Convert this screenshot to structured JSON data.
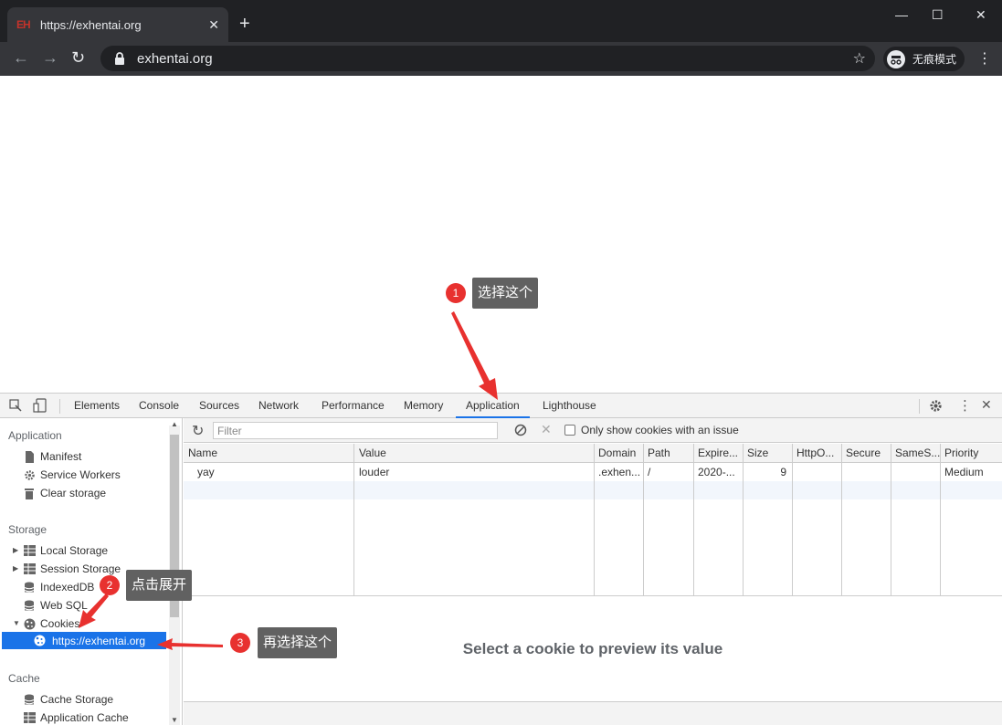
{
  "browser": {
    "tab_title": "https://exhentai.org",
    "favicon_text": "EH",
    "tab_close": "✕",
    "new_tab": "+",
    "address": "exhentai.org",
    "incognito_label": "无痕模式",
    "window_min": "—",
    "window_max": "☐",
    "window_close": "✕",
    "back": "←",
    "forward": "→",
    "reload": "↻",
    "star": "☆",
    "menu": "⋮"
  },
  "devtools": {
    "tabs": [
      "Elements",
      "Console",
      "Sources",
      "Network",
      "Performance",
      "Memory",
      "Application",
      "Lighthouse"
    ],
    "active_tab": "Application",
    "sidebar": {
      "application_header": "Application",
      "application_items": [
        "Manifest",
        "Service Workers",
        "Clear storage"
      ],
      "storage_header": "Storage",
      "storage_items": [
        "Local Storage",
        "Session Storage",
        "IndexedDB",
        "Web SQL",
        "Cookies"
      ],
      "cookie_origin": "https://exhentai.org",
      "cache_header": "Cache",
      "cache_items": [
        "Cache Storage",
        "Application Cache"
      ]
    },
    "filter_placeholder": "Filter",
    "only_issue_label": "Only show cookies with an issue",
    "columns": [
      "Name",
      "Value",
      "Domain",
      "Path",
      "Expire...",
      "Size",
      "HttpO...",
      "Secure",
      "SameS...",
      "Priority"
    ],
    "rows": [
      {
        "name": "yay",
        "value": "louder",
        "domain": ".exhen...",
        "path": "/",
        "expires": "2020-...",
        "size": "9",
        "httponly": "",
        "secure": "",
        "samesite": "",
        "priority": "Medium"
      }
    ],
    "preview_text": "Select a cookie to preview its value"
  },
  "annotations": [
    {
      "num": "1",
      "text": "选择这个"
    },
    {
      "num": "2",
      "text": "点击展开"
    },
    {
      "num": "3",
      "text": "再选择这个"
    }
  ],
  "colors": {
    "accent": "#1a73e8",
    "badge": "#e8312f",
    "arrow": "#e8312f",
    "callout": "#616161"
  }
}
